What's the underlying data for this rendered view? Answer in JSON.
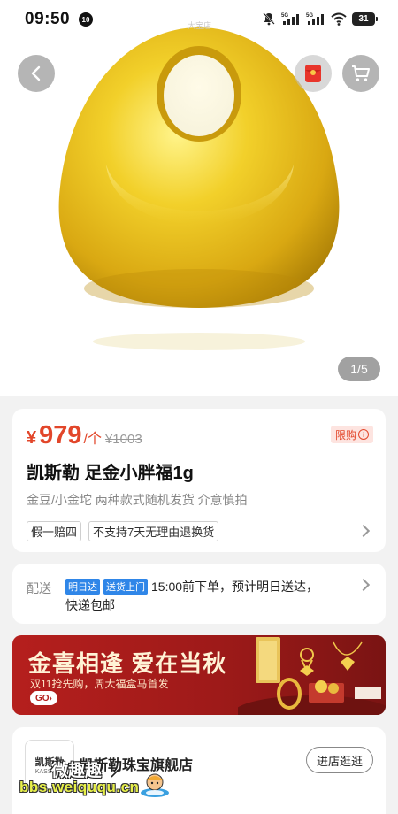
{
  "status_bar": {
    "time": "09:50",
    "notif_badge": "10",
    "net1": "5G",
    "net2": "5G",
    "battery": "31"
  },
  "hero": {
    "store_watermark": "大宝店",
    "page_indicator": "1/5"
  },
  "price": {
    "symbol": "¥",
    "value": "979",
    "unit": "/个",
    "original": "¥1003",
    "limit_badge": "限购",
    "limit_icon": "ⓘ"
  },
  "product": {
    "title": "凯斯勒 足金小胖福1g",
    "subtitle": "金豆/小金坨 两种款式随机发货 介意慎拍",
    "guarantees": [
      "假一赔四",
      "不支持7天无理由退换货"
    ]
  },
  "delivery": {
    "label": "配送",
    "tag1": "明日达",
    "tag2": "送货上门",
    "line1": "15:00前下单，预计明日送达，",
    "line2": "快递包邮"
  },
  "banner": {
    "title": "金喜相逢 爱在当秋",
    "subtitle": "双11抢先购，周大福盒马首发",
    "go": "GO›"
  },
  "store": {
    "logo_cn": "凯斯勒",
    "logo_en": "KASSLER",
    "name": "凯斯勒珠宝旗舰店",
    "visit_button": "进店逛逛"
  },
  "watermark": {
    "cn": "微趣趣",
    "url": "bbs.weiququ.cn"
  },
  "colors": {
    "price_red": "#e2462a",
    "gold": "#e7c21c",
    "banner_red": "#b51f1d",
    "delivery_blue": "#2f86e8"
  },
  "icons": {
    "back": "chevron-left-icon",
    "cart": "cart-icon",
    "red_packet": "red-packet-icon"
  }
}
